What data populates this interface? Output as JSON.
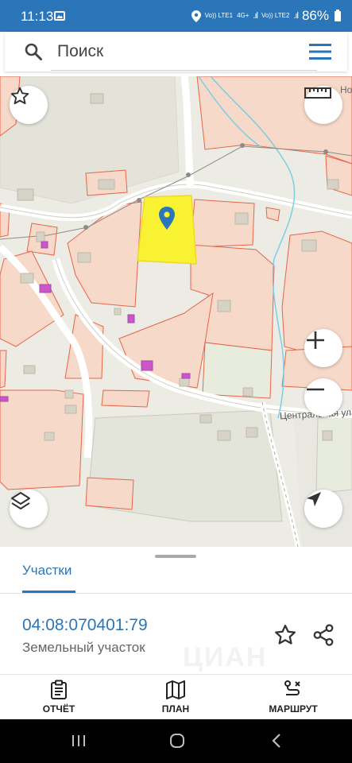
{
  "status_bar": {
    "time": "11:13",
    "network_1": "Vo)) LTE1",
    "network_2": "Vo)) LTE2",
    "lte_label": "4G+",
    "battery": "86%"
  },
  "search": {
    "placeholder": "Поиск"
  },
  "map": {
    "street_label": "Центральная ул",
    "place_label": "Но"
  },
  "sheet": {
    "tab_label": "Участки",
    "cadastral_number": "04:08:070401:79",
    "plot_type": "Земельный участок",
    "watermark": "ЦИАН"
  },
  "bottom_nav": {
    "report": "ОТЧЁТ",
    "plan": "ПЛАН",
    "route": "МАРШРУТ"
  },
  "colors": {
    "accent": "#2a76b8",
    "selected_plot": "#f8f232",
    "plot_border": "#e8644a",
    "plot_fill": "#f6d9c8"
  }
}
